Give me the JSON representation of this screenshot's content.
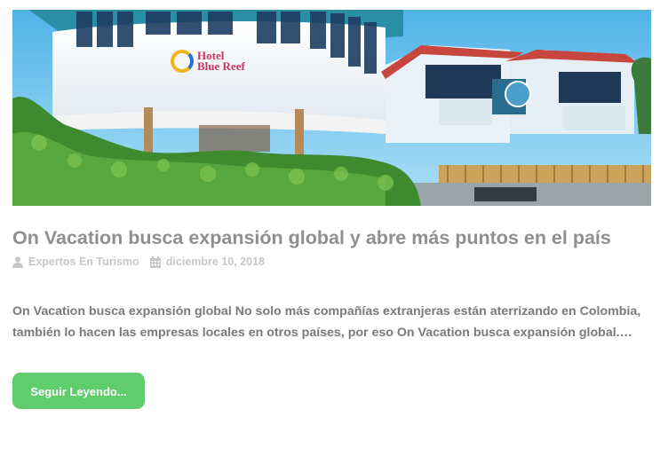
{
  "post": {
    "image_alt": "Hotel Blue Reef",
    "image_sign": {
      "line1": "Hotel",
      "line2": "Blue Reef"
    },
    "title": "On Vacation busca expansión global y abre más puntos en el país",
    "author": "Expertos En Turismo",
    "date": "diciembre 10, 2018",
    "excerpt": "On Vacation busca expansión global No solo más compañías extranjeras están aterrizando en Colombia, también lo hacen las empresas locales en otros países, por eso On Vacation busca expansión global.…",
    "read_more_label": "Seguir Leyendo..."
  },
  "icons": {
    "author": "user-icon",
    "date": "calendar-icon"
  },
  "colors": {
    "title": "#8f8f8f",
    "meta": "#c7c7c7",
    "excerpt": "#7a7a7a",
    "button": "#5fcd6e",
    "button_text": "#ffffff"
  }
}
